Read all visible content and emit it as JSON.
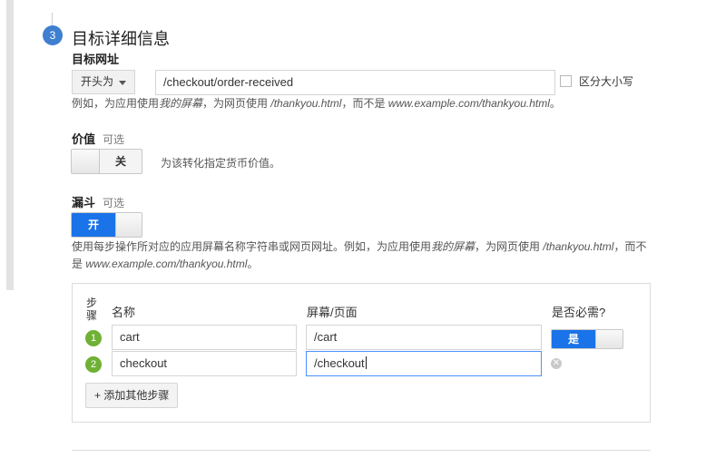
{
  "section": {
    "step_number": "3",
    "title": "目标详细信息"
  },
  "target_url": {
    "label": "目标网址",
    "match_type": "开头为",
    "value": "/checkout/order-received",
    "case_sensitive_label": "区分大小写",
    "case_sensitive_checked": false,
    "help_prefix": "例如，为应用使用",
    "help_app_example": "我的屏幕",
    "help_mid": "，为网页使用",
    "help_web_example": "/thankyou.html",
    "help_mid2": "，而不是",
    "help_bad_example": "www.example.com/thankyou.html",
    "help_suffix": "。"
  },
  "value": {
    "label": "价值",
    "optional": "可选",
    "toggle_state": "关",
    "description": "为该转化指定货币价值。"
  },
  "funnel": {
    "label": "漏斗",
    "optional": "可选",
    "toggle_state": "开",
    "help_prefix": "使用每步操作所对应的应用屏幕名称字符串或网页网址。例如，为应用使用",
    "help_app_example": "我的屏幕",
    "help_mid": "，为网页使用",
    "help_web_example": "/thankyou.html",
    "help_mid2": "，而不",
    "help_line2_prefix": "是",
    "help_bad_example": "www.example.com/thankyou.html",
    "help_suffix": "。",
    "columns": {
      "step": "步骤",
      "name": "名称",
      "screen_page": "屏幕/页面",
      "required": "是否必需?"
    },
    "steps": [
      {
        "number": "1",
        "name": "cart",
        "page": "/cart",
        "required_label": "是"
      },
      {
        "number": "2",
        "name": "checkout",
        "page": "/checkout"
      }
    ],
    "add_step_label": "+ 添加其他步骤",
    "remove_icon": "close-circle-icon"
  },
  "colors": {
    "accent_blue": "#1a73e8",
    "step_badge_blue": "#3f7fd0",
    "step_green": "#6fb134"
  }
}
